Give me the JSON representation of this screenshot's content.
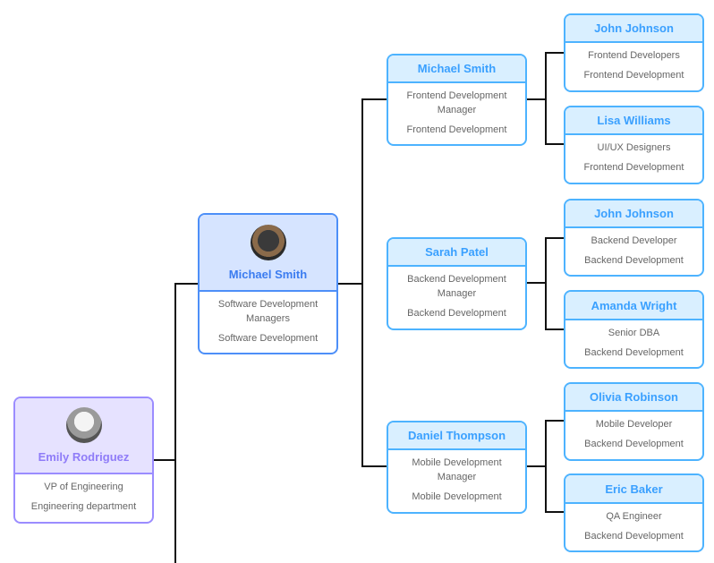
{
  "root": {
    "name": "Emily Rodriguez",
    "title": "VP of Engineering",
    "dept": "Engineering department",
    "avatar": "person-photo"
  },
  "l2": {
    "name": "Michael Smith",
    "title": "Software Development Managers",
    "dept": "Software Development",
    "avatar": "person-photo"
  },
  "managers": [
    {
      "name": "Michael Smith",
      "title": "Frontend Development Manager",
      "dept": "Frontend Development"
    },
    {
      "name": "Sarah Patel",
      "title": "Backend Development Manager",
      "dept": "Backend Development"
    },
    {
      "name": "Daniel Thompson",
      "title": "Mobile Development Manager",
      "dept": "Mobile Development"
    }
  ],
  "staff": [
    {
      "name": "John Johnson",
      "title": "Frontend Developers",
      "dept": "Frontend Development"
    },
    {
      "name": "Lisa Williams",
      "title": "UI/UX Designers",
      "dept": "Frontend Development"
    },
    {
      "name": "John Johnson",
      "title": "Backend Developer",
      "dept": "Backend Development"
    },
    {
      "name": "Amanda Wright",
      "title": "Senior DBA",
      "dept": "Backend Development"
    },
    {
      "name": "Olivia Robinson",
      "title": "Mobile Developer",
      "dept": "Backend Development"
    },
    {
      "name": "Eric Baker",
      "title": "QA Engineer",
      "dept": "Backend Development"
    }
  ],
  "colors": {
    "root": "#9b8cff",
    "l2": "#4d8ff8",
    "team": "#4db3ff",
    "connector": "#111111"
  }
}
